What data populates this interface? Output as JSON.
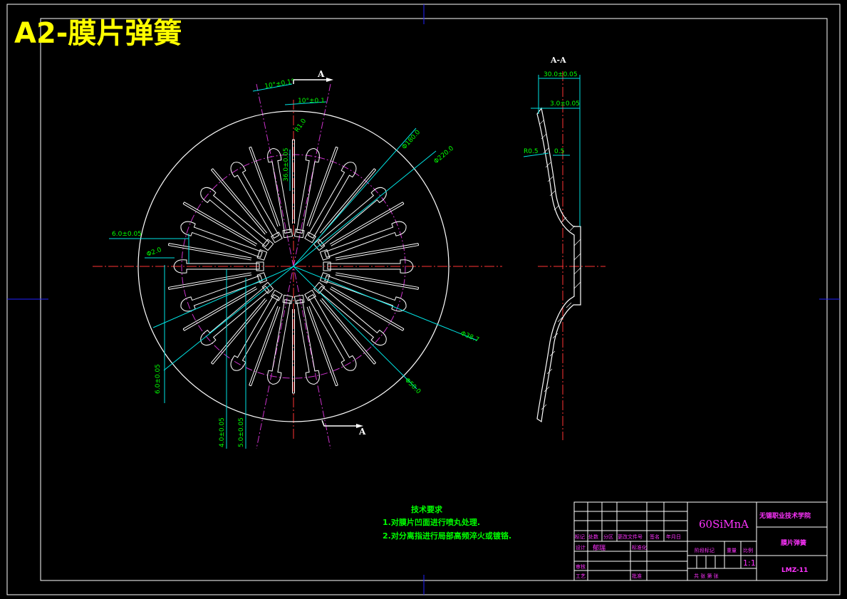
{
  "header": {
    "title": "A2-膜片弹簧"
  },
  "section": {
    "top_marker": "A",
    "bottom_marker": "A",
    "section_title": "A-A"
  },
  "dimensions": {
    "angle_outer": "10°±0.1°",
    "angle_inner": "10°±0.1",
    "radius_tip": "R1.0",
    "slot_length": "36.0±0.05",
    "dia_180": "Φ180.0",
    "dia_220": "Φ220.0",
    "dia_2": "Φ2.0",
    "width_6_h": "6.0±0.05",
    "width_6_v": "6.0±0.05",
    "width_4": "4.0±0.05",
    "width_5": "5.0±0.05",
    "dia_mid": "Φ38.7",
    "dia_small": "Φ50.0"
  },
  "section_dims": {
    "overall": "30.0±0.05",
    "thickness": "3.0±0.05",
    "radius": "R0.5",
    "value": "0.5"
  },
  "notes": {
    "heading": "技术要求",
    "items": [
      "1.对膜片凹面进行喷丸处理.",
      "2.对分离指进行局部高频淬火或镀铬."
    ]
  },
  "title_block": {
    "material": "60SiMnA",
    "school": "无锡职业技术学院",
    "part_name": "膜片弹簧",
    "drawing_no": "LMZ-11",
    "scale": "1:1",
    "hdr_mark": "标记",
    "hdr_count": "处数",
    "hdr_zone": "分区",
    "hdr_doc": "更改文件号",
    "hdr_sign": "签名",
    "hdr_date": "年月日",
    "design": "设计",
    "designer": "郁瑞",
    "standard": "标准化",
    "check": "审核",
    "process": "工艺",
    "approve": "批准",
    "stage": "阶段标记",
    "weight": "重量",
    "ratio": "比例",
    "sheets": "共  张 第  张"
  }
}
